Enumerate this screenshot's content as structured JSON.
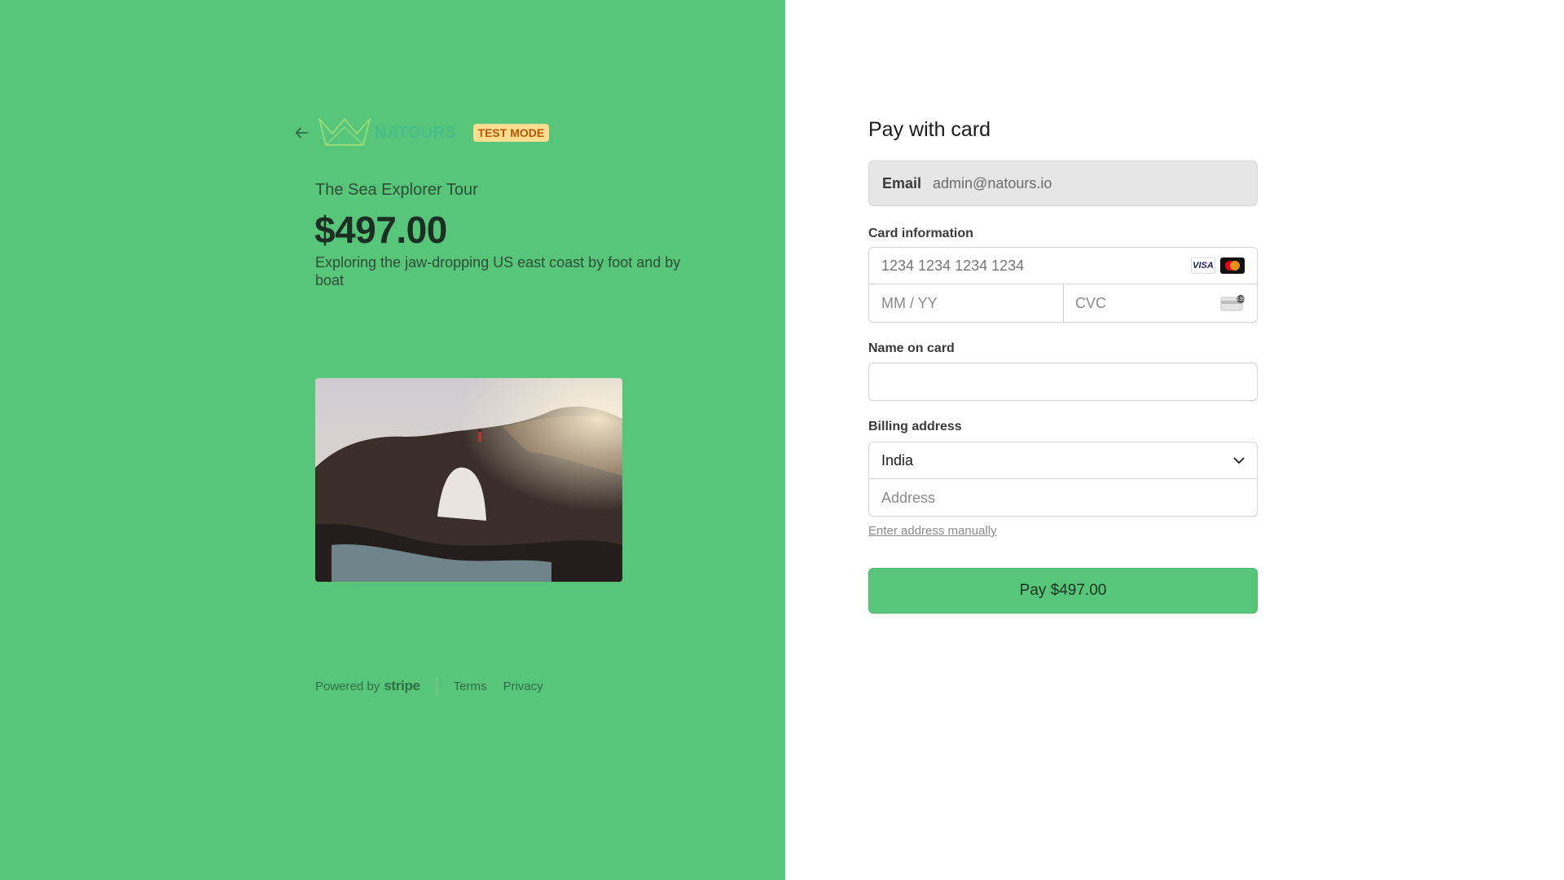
{
  "header": {
    "test_mode_badge": "TEST MODE",
    "logo_text": "NATOURS"
  },
  "product": {
    "name": "The Sea Explorer Tour",
    "price": "$497.00",
    "description": "Exploring the jaw-dropping US east coast by foot and by boat"
  },
  "footer": {
    "powered_by": "Powered by",
    "stripe": "stripe",
    "terms": "Terms",
    "privacy": "Privacy"
  },
  "form": {
    "title": "Pay with card",
    "email_label": "Email",
    "email_value": "admin@natours.io",
    "card_info_label": "Card information",
    "card_number_placeholder": "1234 1234 1234 1234",
    "expiry_placeholder": "MM / YY",
    "cvc_placeholder": "CVC",
    "brands": [
      "VISA",
      "mastercard"
    ],
    "name_label": "Name on card",
    "name_value": "",
    "billing_label": "Billing address",
    "country_selected": "India",
    "address_placeholder": "Address",
    "manual_link": "Enter address manually",
    "pay_button": "Pay $497.00"
  },
  "colors": {
    "left_panel_bg": "#57c57a",
    "pay_button_bg": "#57c57a",
    "test_badge_bg": "#ffde92",
    "test_badge_text": "#bb5504"
  },
  "icons": {
    "back": "arrow-left-icon",
    "logo": "crown-logo-icon",
    "chevron": "chevron-down-icon",
    "cvc": "card-back-icon"
  }
}
